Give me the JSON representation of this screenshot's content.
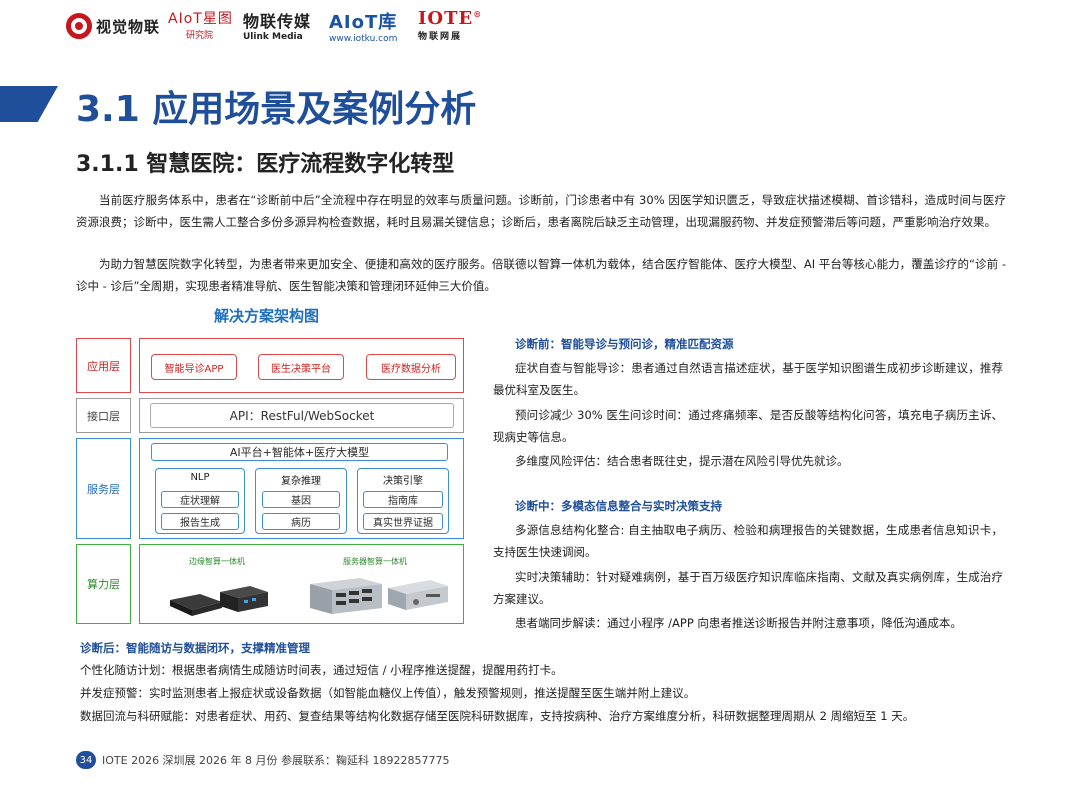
{
  "header": {
    "logos": [
      {
        "text": "视觉物联",
        "icon": "vision-iot-logo-icon"
      },
      {
        "text": "AIoT星图",
        "sub": "研究院"
      },
      {
        "text": "物联传媒",
        "sub": "Ulink Media"
      },
      {
        "text": "AIoT库",
        "sub": "www.iotku.com"
      },
      {
        "text": "IOTE",
        "sub": "物联网展",
        "mark": "®"
      }
    ]
  },
  "title": "3.1 应用场景及案例分析",
  "subtitle": "3.1.1  智慧医院：医疗流程数字化转型",
  "paragraphs": [
    "当前医疗服务体系中，患者在“诊断前中后”全流程中存在明显的效率与质量问题。诊断前，门诊患者中有 30% 因医学知识匮乏，导致症状描述模糊、首诊错科，造成时间与医疗资源浪费；诊断中，医生需人工整合多份多源异构检查数据，耗时且易漏关键信息；诊断后，患者离院后缺乏主动管理，出现漏服药物、并发症预警滞后等问题，严重影响治疗效果。",
    "为助力智慧医院数字化转型，为患者带来更加安全、便捷和高效的医疗服务。倍联德以智算一体机为载体，结合医疗智能体、医疗大模型、AI 平台等核心能力，覆盖诊疗的“诊前 - 诊中 - 诊后”全周期，实现患者精准导航、医生智能决策和管理闭环延伸三大价值。"
  ],
  "diagram": {
    "title": "解决方案架构图",
    "layers": {
      "app": {
        "label": "应用层",
        "items": [
          "智能导诊APP",
          "医生决策平台",
          "医疗数据分析"
        ]
      },
      "api": {
        "label": "接口层",
        "text": "API：RestFul/WebSocket"
      },
      "service": {
        "label": "服务层",
        "banner": "AI平台+智能体+医疗大模型",
        "groups": [
          {
            "title": "NLP",
            "items": [
              "症状理解",
              "报告生成"
            ]
          },
          {
            "title": "复杂推理",
            "items": [
              "基因",
              "病历"
            ]
          },
          {
            "title": "决策引擎",
            "items": [
              "指南库",
              "真实世界证据"
            ]
          }
        ]
      },
      "compute": {
        "label": "算力层",
        "edge": "边缘智算一体机",
        "server": "服务器智算一体机"
      }
    },
    "colors": {
      "app": "#e04848",
      "api": "#9a9a9a",
      "service": "#3a8fd8",
      "compute": "#3fae3f"
    }
  },
  "pre": {
    "heading": "诊断前：智能导诊与预问诊，精准匹配资源",
    "items": [
      "症状自查与智能导诊：患者通过自然语言描述症状，基于医学知识图谱生成初步诊断建议，推荐最优科室及医生。",
      "预问诊减少 30% 医生问诊时间：通过疼痛频率、是否反酸等结构化问答，填充电子病历主诉、现病史等信息。",
      "多维度风险评估：结合患者既往史，提示潜在风险引导优先就诊。"
    ]
  },
  "during": {
    "heading": "诊断中：多模态信息整合与实时决策支持",
    "items": [
      "多源信息结构化整合: 自主抽取电子病历、检验和病理报告的关键数据，生成患者信息知识卡，支持医生快速调阅。",
      "实时决策辅助：针对疑难病例，基于百万级医疗知识库临床指南、文献及真实病例库，生成治疗方案建议。",
      "患者端同步解读：通过小程序 /APP 向患者推送诊断报告并附注意事项，降低沟通成本。"
    ]
  },
  "post": {
    "heading": "诊断后：智能随访与数据闭环，支撑精准管理",
    "items": [
      "个性化随访计划：根据患者病情生成随访时间表，通过短信 / 小程序推送提醒，提醒用药打卡。",
      "并发症预警：实时监测患者上报症状或设备数据（如智能血糖仪上传值），触发预警规则，推送提醒至医生端并附上建议。",
      "数据回流与科研赋能：对患者症状、用药、复查结果等结构化数据存储至医院科研数据库，支持按病种、治疗方案维度分析，科研数据整理周期从 2 周缩短至 1 天。"
    ]
  },
  "footer": {
    "page": "34",
    "text": "IOTE 2026 深圳展 2026 年 8 月份  参展联系：鞠延科 18922857775"
  }
}
